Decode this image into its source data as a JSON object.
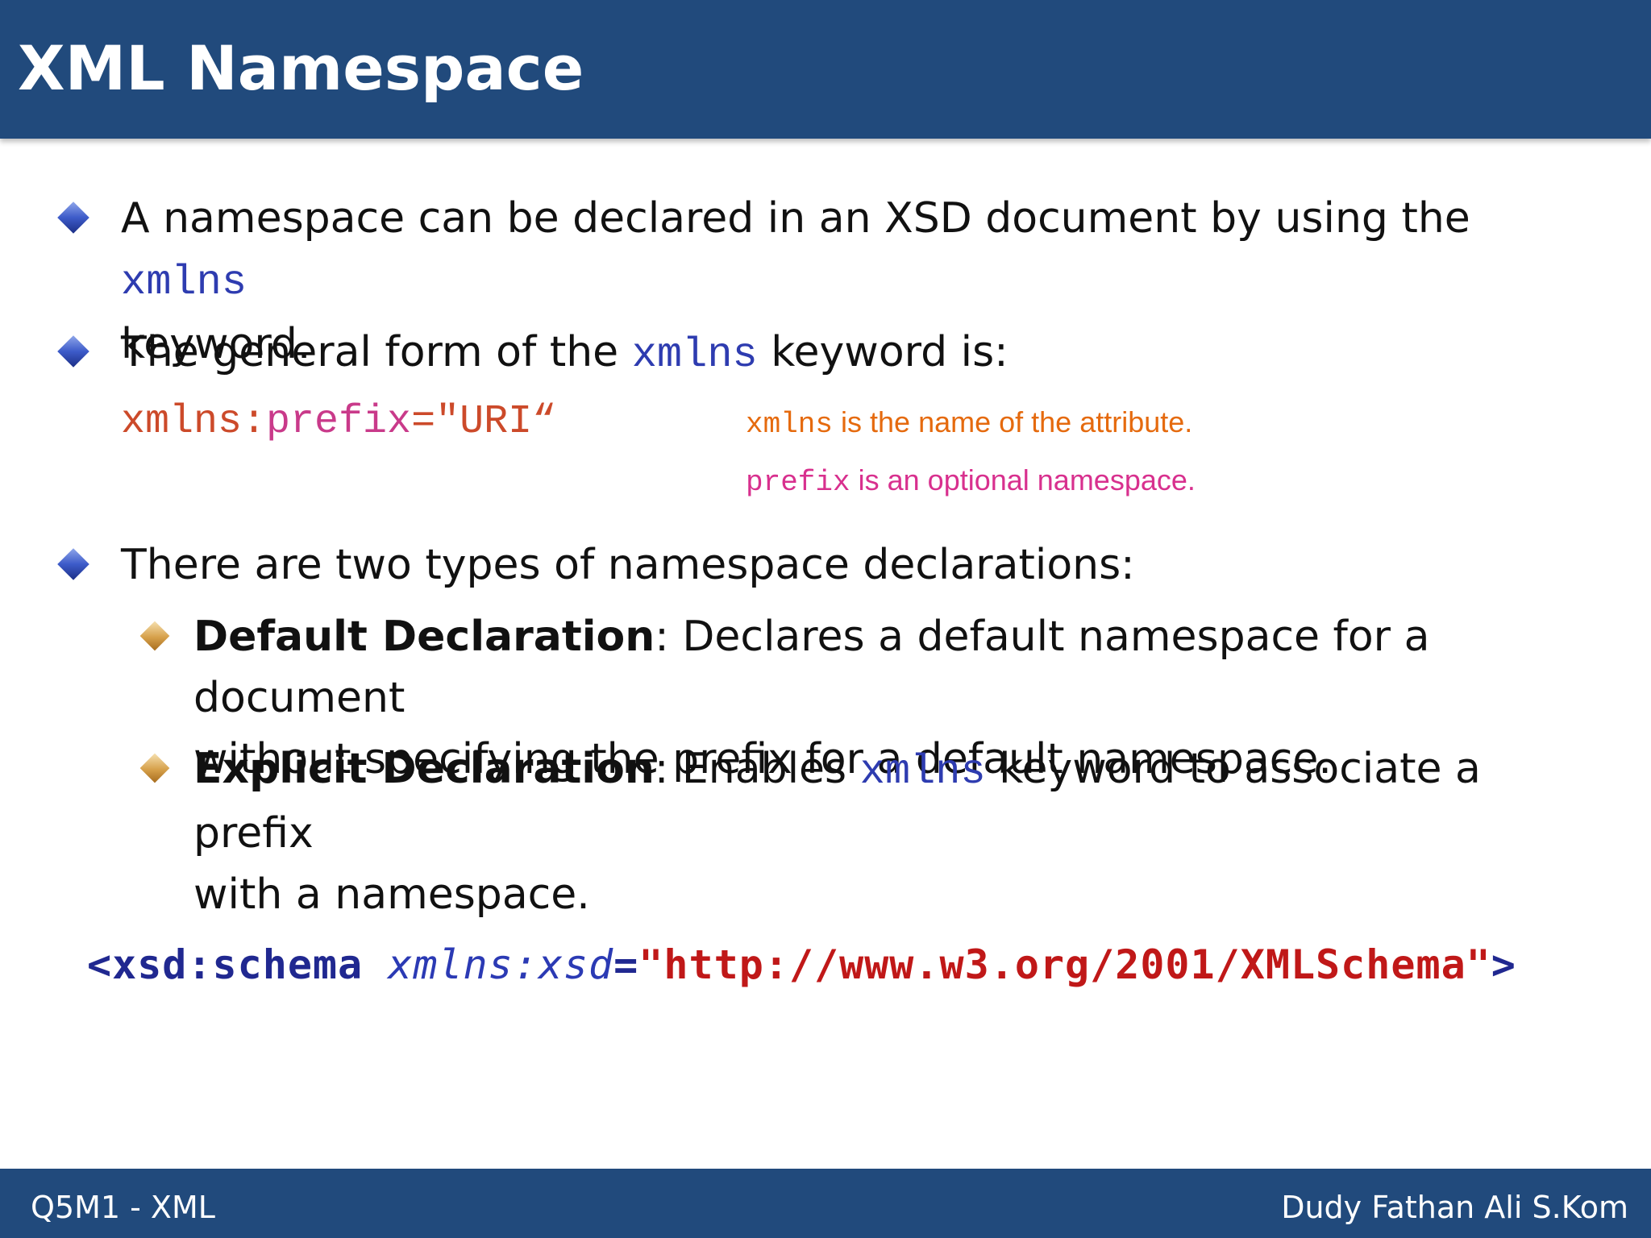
{
  "header": {
    "title": "XML Namespace"
  },
  "bullets": {
    "b1": {
      "text_before": "A namespace can be declared in an XSD document by using the ",
      "keyword": "xmlns",
      "text_after": "keyword."
    },
    "b2": {
      "text_before": "The general form of the ",
      "keyword": "xmlns",
      "text_after": " keyword is:"
    },
    "syntax": {
      "xmlns_part": "xmlns:",
      "prefix_part": "prefix",
      "uri_part": "=\"URI“"
    },
    "notes": {
      "n1_code": "xmlns",
      "n1_text": " is the name of the attribute.",
      "n2_code": "prefix",
      "n2_text": " is an optional namespace."
    },
    "b3": {
      "text": "There are two types of namespace declarations:"
    },
    "sub1": {
      "bold": "Default Declaration",
      "line1": ": Declares a default namespace for a document",
      "line2": "without specifying the prefix for a default namespace."
    },
    "sub2": {
      "bold": "Explicit Declaration",
      "text_before": ": Enables ",
      "keyword": "xmlns",
      "text_after": " keyword to associate a prefix",
      "line2": "with a namespace."
    }
  },
  "code_example": {
    "open": "<xsd:schema ",
    "attr": "xmlns:xsd",
    "eq": "=",
    "value": "\"http://www.w3.org/2001/XMLSchema\"",
    "close": ">"
  },
  "footer": {
    "left": "Q5M1 - XML",
    "right": "Dudy Fathan Ali S.Kom"
  },
  "colors": {
    "header_bg": "#214a7c",
    "keyword_blue": "#2e3cb0",
    "note_orange": "#e56a0e",
    "note_pink": "#d8308e",
    "code_red": "#c01818"
  }
}
